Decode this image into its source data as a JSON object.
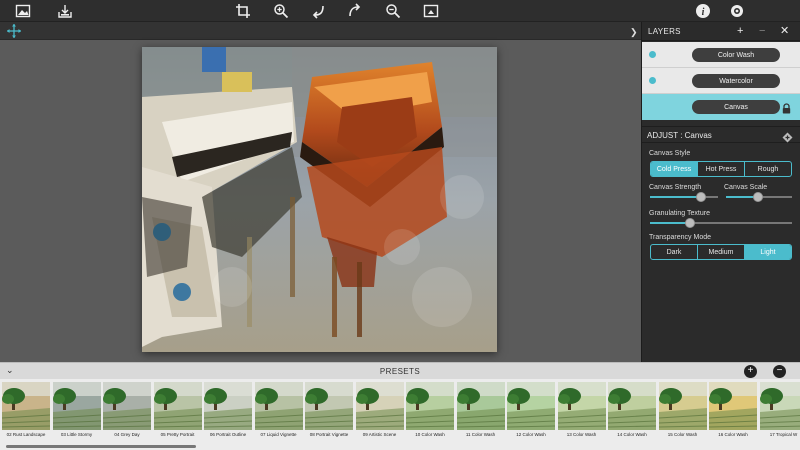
{
  "toolbar": {
    "left_icons": [
      "image-icon",
      "save-icon"
    ],
    "center_icons": [
      "crop-icon",
      "zoom-in-icon",
      "undo-icon",
      "redo-icon",
      "zoom-out-icon",
      "fit-screen-icon"
    ],
    "right_icons": [
      "info-icon",
      "settings-icon"
    ]
  },
  "layers": {
    "title": "LAYERS",
    "items": [
      {
        "label": "Color Wash",
        "visible": true,
        "selected": false
      },
      {
        "label": "Watercolor",
        "visible": true,
        "selected": false
      },
      {
        "label": "Canvas",
        "visible": false,
        "selected": true,
        "locked": true
      }
    ]
  },
  "adjust": {
    "title": "ADJUST : Canvas",
    "canvas_style": {
      "label": "Canvas Style",
      "options": [
        "Cold Press",
        "Hot Press",
        "Rough"
      ],
      "selected": "Cold Press"
    },
    "canvas_strength": {
      "label": "Canvas Strength",
      "value": 0.75
    },
    "canvas_scale": {
      "label": "Canvas Scale",
      "value": 0.48
    },
    "granulating_texture": {
      "label": "Granulating Texture",
      "value": 0.28
    },
    "transparency_mode": {
      "label": "Transparency Mode",
      "options": [
        "Dark",
        "Medium",
        "Light"
      ],
      "selected": "Light"
    }
  },
  "presets": {
    "title": "PRESETS",
    "items": [
      {
        "label": "02 Rust Landscape"
      },
      {
        "label": "03 Little Stormy"
      },
      {
        "label": "04 Grey Day"
      },
      {
        "label": "05 Pretty Portrait"
      },
      {
        "label": "06 Portrait Outline"
      },
      {
        "label": "07 Liquid Vignette"
      },
      {
        "label": "08 Portrait Vignette"
      },
      {
        "label": "09 Artistic Scene"
      },
      {
        "label": "10 Color Wash"
      },
      {
        "label": "11 Color Wash"
      },
      {
        "label": "12 Color Wash"
      },
      {
        "label": "13 Color Wash"
      },
      {
        "label": "14 Color Wash"
      },
      {
        "label": "15 Color Wash"
      },
      {
        "label": "16 Color Wash"
      },
      {
        "label": "17 Tropical W"
      }
    ]
  },
  "colors": {
    "accent": "#4bbccc",
    "panel": "#2b2b2b",
    "workspace": "#5b5b5b"
  }
}
